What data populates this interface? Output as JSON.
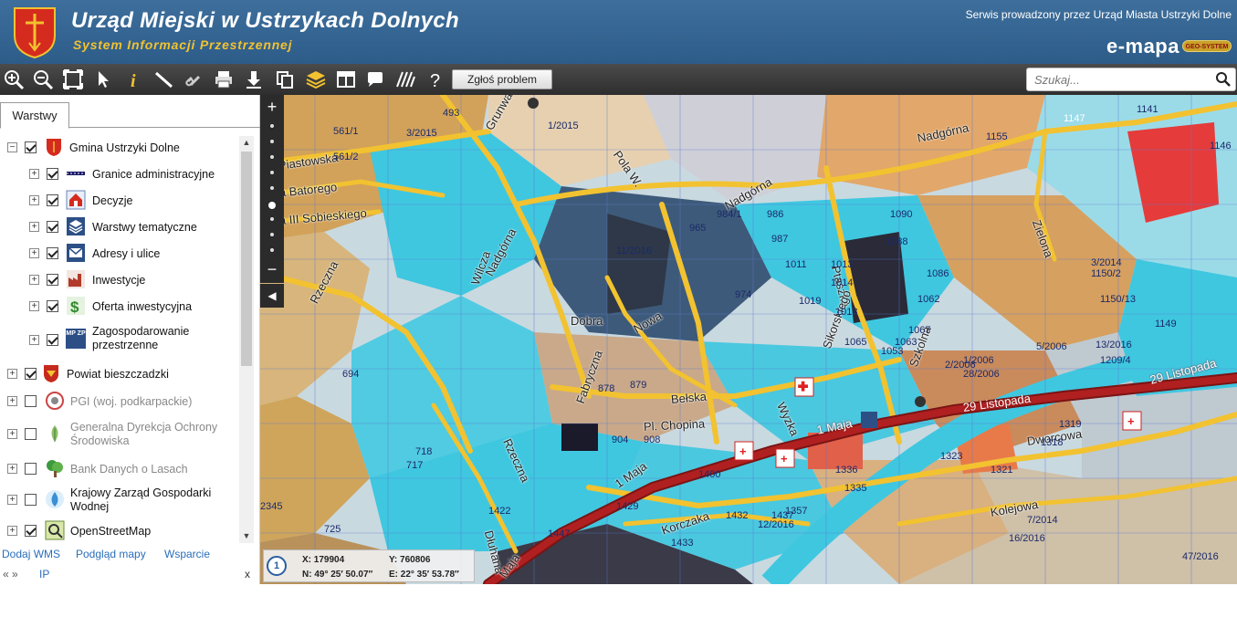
{
  "header": {
    "title": "Urząd Miejski w Ustrzykach Dolnych",
    "subtitle": "System Informacji Przestrzennej",
    "service_note": "Serwis prowadzony przez Urząd Miasta Ustrzyki Dolne",
    "brand": "e-mapa",
    "brand_badge": "GEO-SYSTEM"
  },
  "toolbar": {
    "icons": [
      "zoom-in-icon",
      "zoom-out-icon",
      "zoom-extent-icon",
      "select-arrow-icon",
      "info-icon",
      "measure-ruler-icon",
      "link-icon",
      "print-icon",
      "download-icon",
      "copy-icon",
      "layers-icon",
      "layout-icon",
      "note-icon",
      "hatch-icon",
      "help-icon"
    ],
    "report_button": "Zgłoś problem",
    "search_placeholder": "Szukaj..."
  },
  "sidebar": {
    "tab": "Warstwy",
    "layers": [
      {
        "label": "Gmina Ustrzyki Dolne",
        "checked": true,
        "expand": "−",
        "icon": "crest-icon",
        "level": 0,
        "enabled": true
      },
      {
        "label": "Granice administracyjne",
        "checked": true,
        "expand": "+",
        "icon": "boundary-icon",
        "level": 1,
        "enabled": true
      },
      {
        "label": "Decyzje",
        "checked": true,
        "expand": "+",
        "icon": "decision-house-icon",
        "level": 1,
        "enabled": true
      },
      {
        "label": "Warstwy tematyczne",
        "checked": true,
        "expand": "+",
        "icon": "layers-stack-icon",
        "level": 1,
        "enabled": true
      },
      {
        "label": "Adresy i ulice",
        "checked": true,
        "expand": "+",
        "icon": "envelope-icon",
        "level": 1,
        "enabled": true
      },
      {
        "label": "Inwestycje",
        "checked": true,
        "expand": "+",
        "icon": "factory-icon",
        "level": 1,
        "enabled": true
      },
      {
        "label": "Oferta inwestycyjna",
        "checked": true,
        "expand": "+",
        "icon": "dollar-icon",
        "level": 1,
        "enabled": true
      },
      {
        "label": "Zagospodarowanie przestrzenne",
        "checked": true,
        "expand": "+",
        "icon": "mpzp-icon",
        "level": 1,
        "enabled": true,
        "icon_text": "MP ZP"
      },
      {
        "label": "Powiat bieszczadzki",
        "checked": true,
        "expand": "+",
        "icon": "county-crest-icon",
        "level": 0,
        "enabled": true
      },
      {
        "label": "PGI (woj. podkarpackie)",
        "checked": false,
        "expand": "+",
        "icon": "pgi-icon",
        "level": 0,
        "enabled": false
      },
      {
        "label": "Generalna Dyrekcja Ochrony Środowiska",
        "checked": false,
        "expand": "+",
        "icon": "leaf-icon",
        "level": 0,
        "enabled": false
      },
      {
        "label": "Bank Danych o Lasach",
        "checked": false,
        "expand": "+",
        "icon": "tree-icon",
        "level": 0,
        "enabled": false
      },
      {
        "label": "Krajowy Zarząd Gospodarki Wodnej",
        "checked": false,
        "expand": "+",
        "icon": "water-drop-icon",
        "level": 0,
        "enabled": true
      },
      {
        "label": "OpenStreetMap",
        "checked": true,
        "expand": "+",
        "icon": "osm-icon",
        "level": 0,
        "enabled": true
      }
    ],
    "links": [
      "Dodaj WMS",
      "Podgląd mapy",
      "Wsparcie"
    ],
    "footer": {
      "arrows": "« »",
      "ip": "IP",
      "close": "x"
    }
  },
  "map": {
    "scale_marker": "1",
    "coords": {
      "x": "X: 179904",
      "y": "Y: 760806",
      "n": "N: 49° 25′ 50.07″",
      "e": "E: 22° 35′ 53.78″"
    },
    "zoom_levels": 9,
    "zoom_in": "+",
    "zoom_out": "−",
    "collapse": "◀",
    "streets": [
      "Piastowska",
      "Jana Batorego",
      "Jana III Sobieskiego",
      "Wilcza",
      "Rzeczna",
      "Nadgórna",
      "Grunwaldzka",
      "Pola W.",
      "Nadgórna",
      "Nadgórna",
      "Zielona",
      "Dobra",
      "Nowa",
      "Fabryczna",
      "Ptaszka",
      "Sikorskiego",
      "Szkolna",
      "Bełska",
      "Pl. Chopina",
      "Wyzka",
      "1 Maja",
      "29 Listopada",
      "29 Listopada",
      "Dworcowa",
      "Kolejowa",
      "Korczaka",
      "Dłuhana",
      "Rzeczna",
      "1 Maja",
      "Maja"
    ],
    "parcels": [
      "493",
      "561/1",
      "561/2",
      "3/2015",
      "1/2015",
      "1147",
      "1141",
      "1146",
      "1150/2",
      "3/2014",
      "11/2016",
      "965",
      "984/1",
      "986",
      "987",
      "974",
      "1011",
      "1014",
      "1013",
      "1019",
      "1018",
      "1088",
      "1090",
      "1086",
      "1062",
      "1063",
      "1053",
      "1065",
      "1067",
      "1149",
      "1150/13",
      "13/2016",
      "5/2006",
      "28/2006",
      "1209/4",
      "879",
      "878",
      "904",
      "908",
      "1400",
      "1429",
      "1432",
      "1437",
      "1357",
      "1336",
      "1335",
      "1323",
      "1321",
      "1318",
      "1319",
      "7/2014",
      "16/2016",
      "47/2016",
      "12/2016",
      "2345",
      "725",
      "717",
      "718",
      "694",
      "1433",
      "1422",
      "1447",
      "2/2006",
      "1/2006",
      "1155"
    ]
  }
}
